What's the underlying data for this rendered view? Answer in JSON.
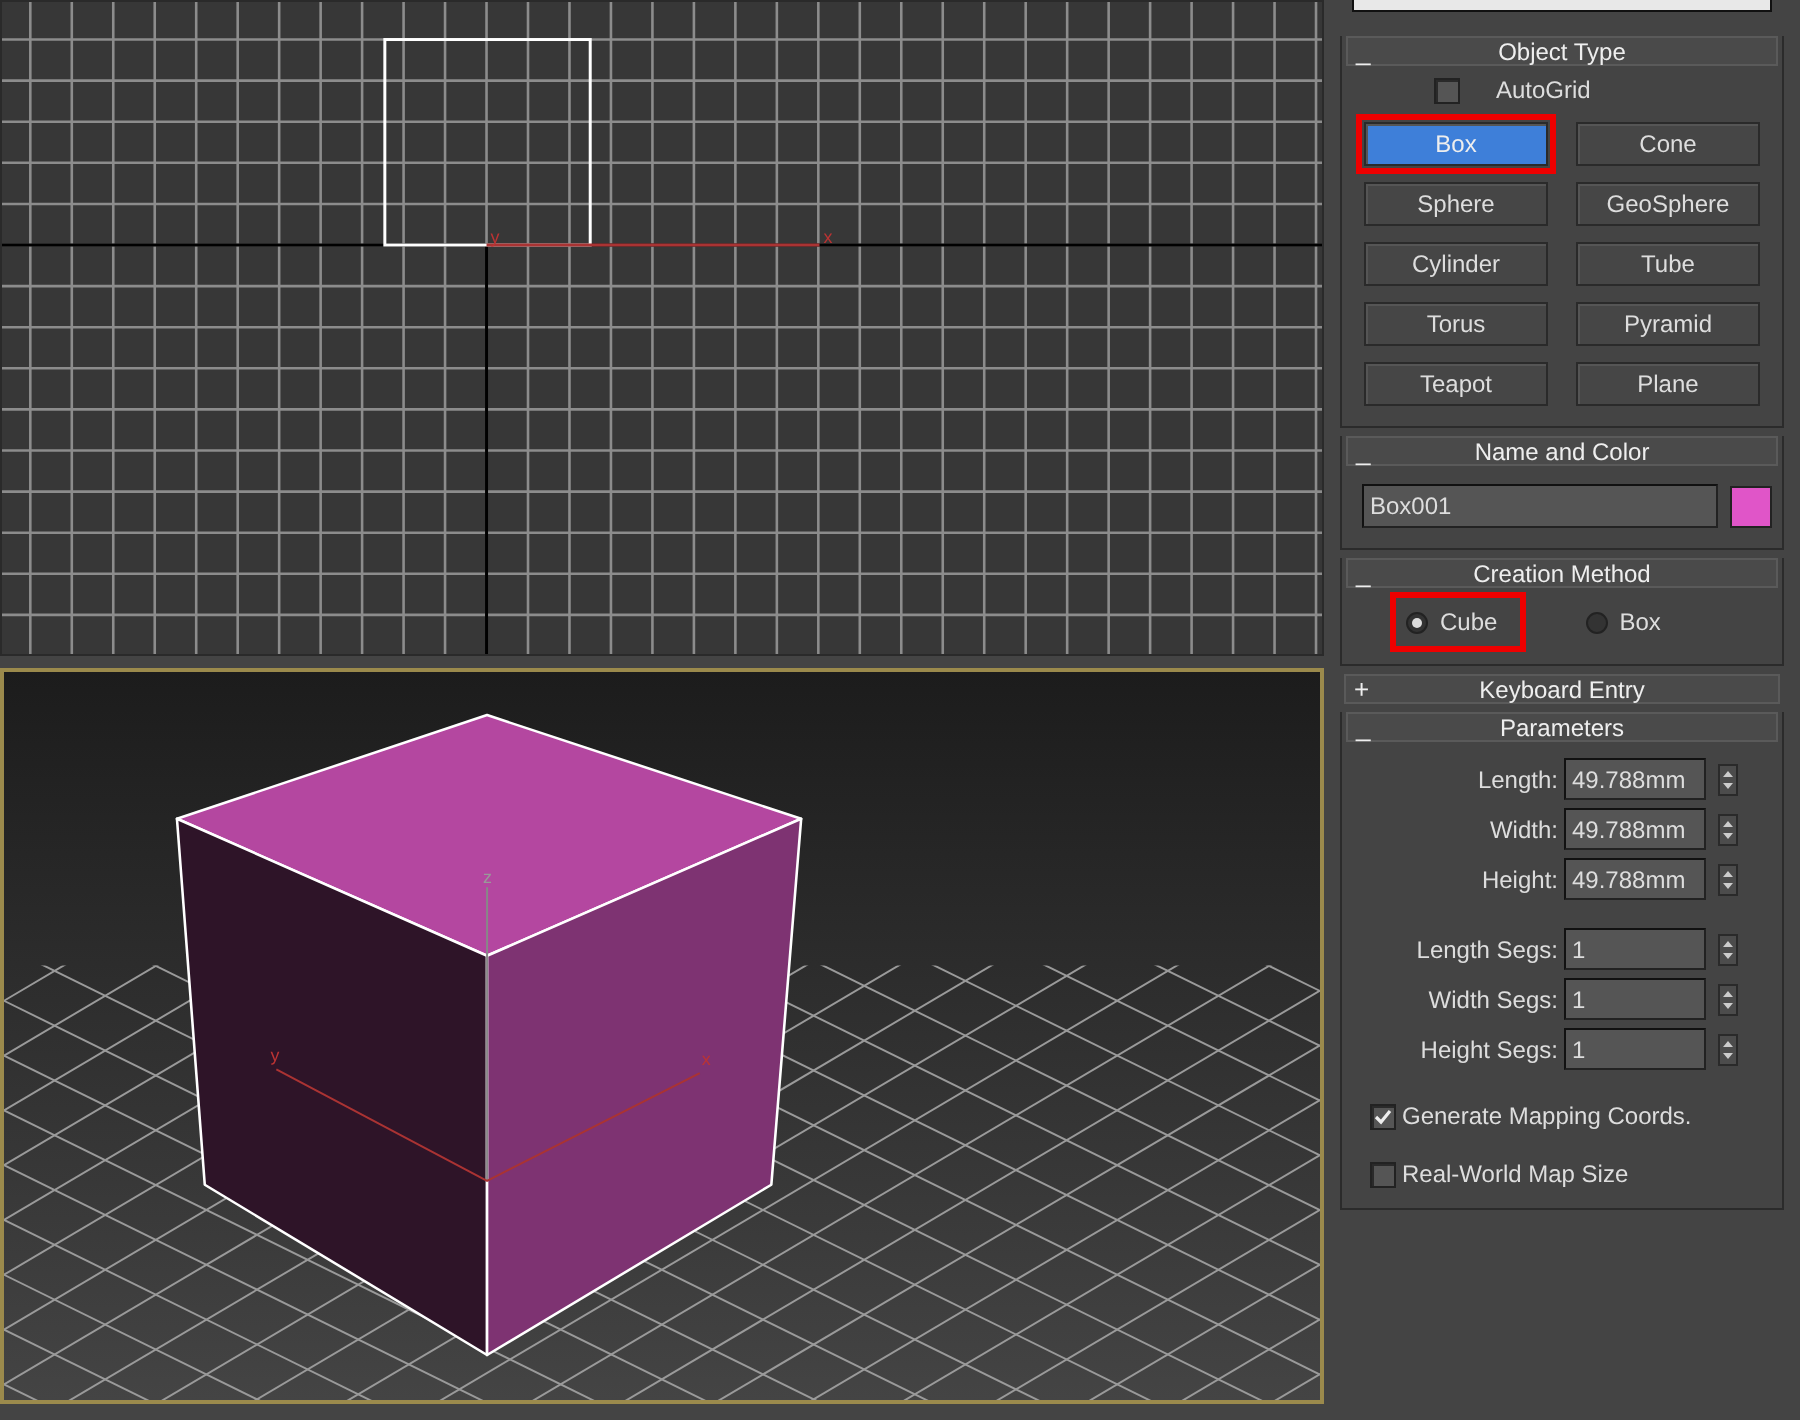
{
  "viewports": [
    {
      "kind": "top",
      "active": false,
      "axis_labels": [
        "y",
        "x"
      ]
    },
    {
      "kind": "perspective",
      "active": true,
      "axis_labels": [
        "z",
        "y",
        "x"
      ]
    }
  ],
  "rollouts": [
    {
      "kind": "object_type",
      "toggle": "_",
      "title": "Object Type",
      "autogrid": {
        "label": "AutoGrid",
        "checked": false
      },
      "buttons": [
        {
          "label": "Box",
          "selected": true,
          "highlighted": true
        },
        {
          "label": "Cone",
          "selected": false,
          "highlighted": false
        },
        {
          "label": "Sphere",
          "selected": false,
          "highlighted": false
        },
        {
          "label": "GeoSphere",
          "selected": false,
          "highlighted": false
        },
        {
          "label": "Cylinder",
          "selected": false,
          "highlighted": false
        },
        {
          "label": "Tube",
          "selected": false,
          "highlighted": false
        },
        {
          "label": "Torus",
          "selected": false,
          "highlighted": false
        },
        {
          "label": "Pyramid",
          "selected": false,
          "highlighted": false
        },
        {
          "label": "Teapot",
          "selected": false,
          "highlighted": false
        },
        {
          "label": "Plane",
          "selected": false,
          "highlighted": false
        }
      ]
    },
    {
      "kind": "name_color",
      "toggle": "_",
      "title": "Name and Color",
      "name_value": "Box001",
      "color": "#e055c8"
    },
    {
      "kind": "creation_method",
      "toggle": "_",
      "title": "Creation Method",
      "options": [
        {
          "label": "Cube",
          "selected": true,
          "highlighted": true
        },
        {
          "label": "Box",
          "selected": false,
          "highlighted": false
        }
      ]
    },
    {
      "kind": "collapsed",
      "toggle": "+",
      "title": "Keyboard Entry"
    },
    {
      "kind": "parameters",
      "toggle": "_",
      "title": "Parameters",
      "field_groups": [
        [
          {
            "label": "Length:",
            "value": "49.788mm"
          },
          {
            "label": "Width:",
            "value": "49.788mm"
          },
          {
            "label": "Height:",
            "value": "49.788mm"
          }
        ],
        [
          {
            "label": "Length Segs:",
            "value": "1"
          },
          {
            "label": "Width Segs:",
            "value": "1"
          },
          {
            "label": "Height Segs:",
            "value": "1"
          }
        ]
      ],
      "checkboxes": [
        {
          "label": "Generate Mapping Coords.",
          "checked": true
        },
        {
          "label": "Real-World Map Size",
          "checked": false
        }
      ]
    }
  ]
}
